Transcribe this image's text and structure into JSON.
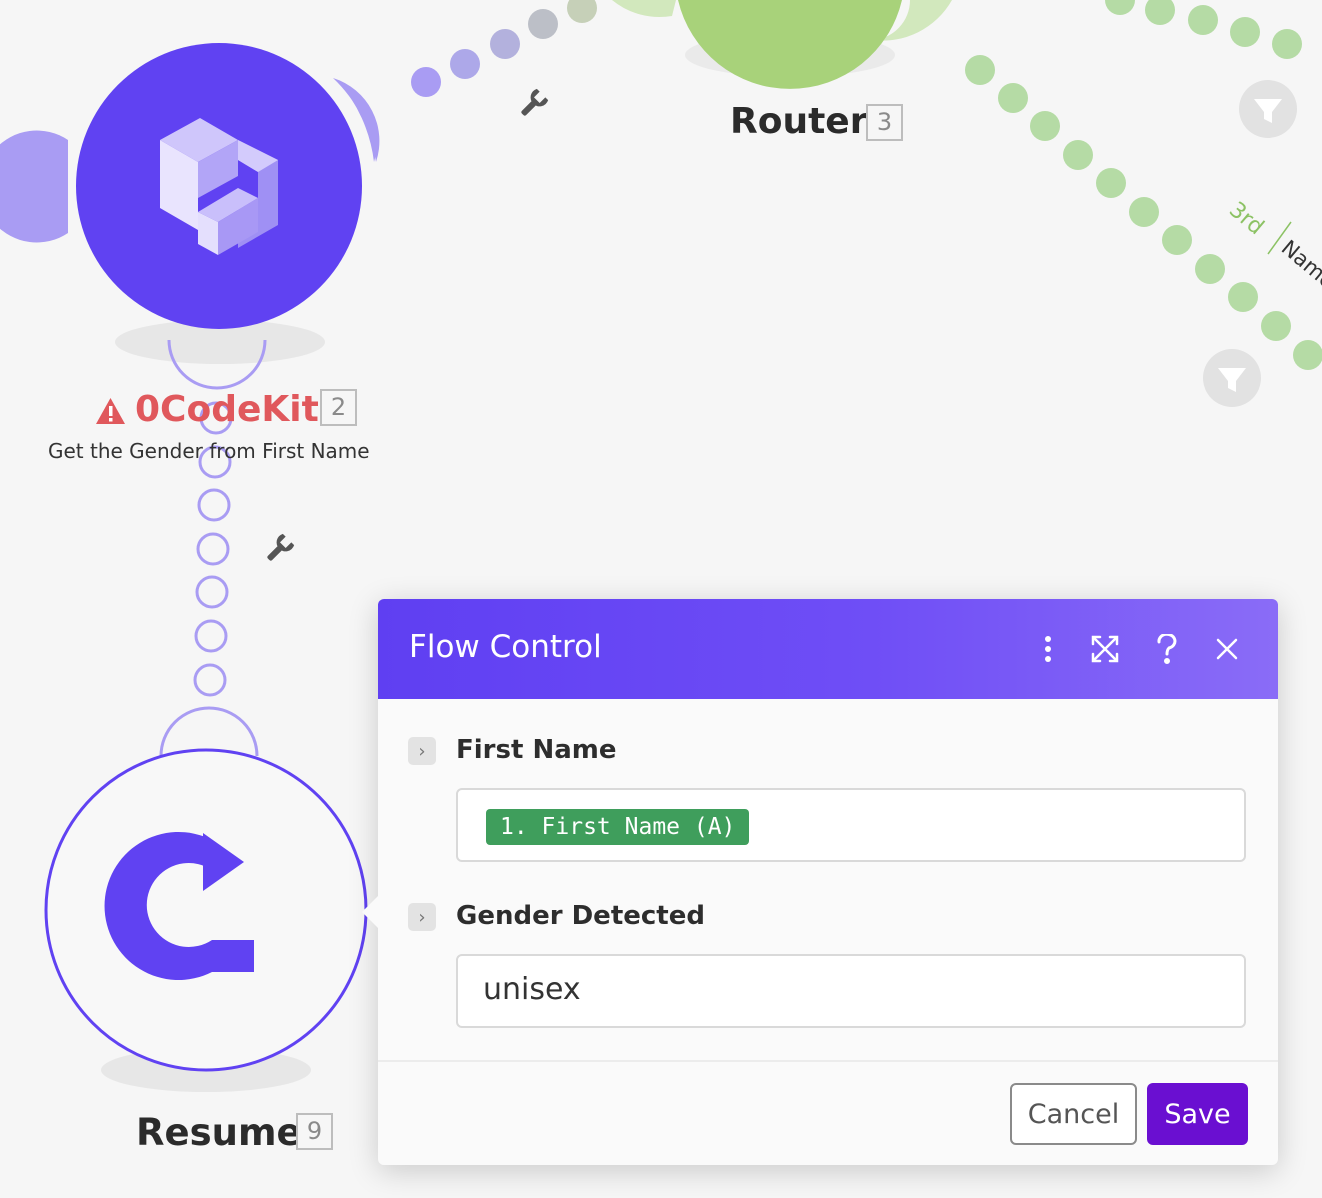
{
  "nodes": {
    "router": {
      "title": "Router",
      "badge": "3"
    },
    "ocodekit": {
      "title": "0CodeKit",
      "badge": "2",
      "subtitle": "Get the Gender from First Name"
    },
    "resume": {
      "title": "Resume",
      "badge": "9"
    }
  },
  "route_label": {
    "order": "3rd",
    "name": "Name"
  },
  "panel": {
    "title": "Flow Control",
    "fields": [
      {
        "label": "First Name",
        "value_pill": "1. First Name (A)"
      },
      {
        "label": "Gender Detected",
        "value": "unisex"
      }
    ],
    "cancel_label": "Cancel",
    "save_label": "Save"
  },
  "colors": {
    "accent": "#6042f2",
    "router_green": "#a8d27a",
    "route_dot_green": "#b5dba5",
    "pill_green": "#3f9e5c",
    "save": "#6a0fd1",
    "warning": "#e0585c"
  },
  "icons": {
    "header_menu": "kebab-icon",
    "header_expand": "expand-icon",
    "header_help": "help-icon",
    "header_close": "close-icon",
    "wrench": "wrench-icon",
    "filter": "filter-icon",
    "warning": "warning-icon",
    "resume": "redo-arrow-icon"
  }
}
